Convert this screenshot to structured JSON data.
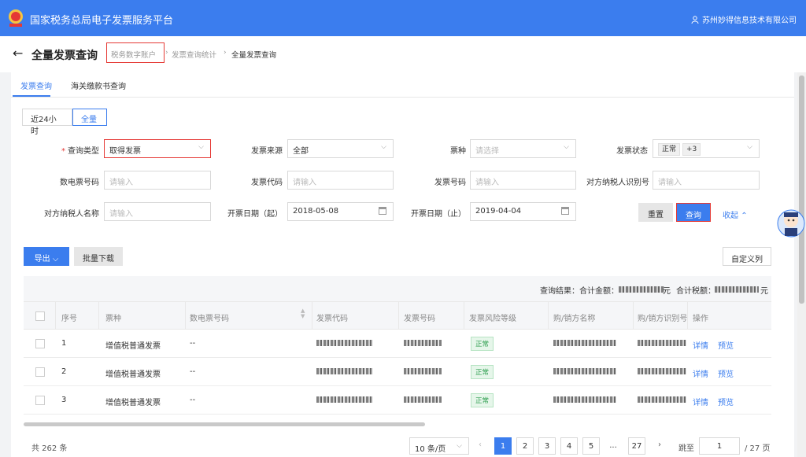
{
  "header": {
    "title": "国家税务总局电子发票服务平台",
    "user": "苏州妙得信息技术有限公司"
  },
  "breadcrumb": {
    "page_title": "全量发票查询",
    "items": [
      "税务数字账户",
      "发票查询统计",
      "全量发票查询"
    ]
  },
  "tabs": [
    "发票查询",
    "海关缴款书查询"
  ],
  "time_range": [
    "近24小时",
    "全量"
  ],
  "form": {
    "query_type_label": "查询类型",
    "query_type_value": "取得发票",
    "source_label": "发票来源",
    "source_value": "全部",
    "kind_label": "票种",
    "kind_placeholder": "请选择",
    "status_label": "发票状态",
    "status_tag": "正常",
    "status_more": "+3",
    "digital_no_label": "数电票号码",
    "digital_no_placeholder": "请输入",
    "code_label": "发票代码",
    "code_placeholder": "请输入",
    "number_label": "发票号码",
    "number_placeholder": "请输入",
    "taxid_label": "对方纳税人识别号",
    "taxid_placeholder": "请输入",
    "name_label": "对方纳税人名称",
    "name_placeholder": "请输入",
    "date_start_label": "开票日期（起）",
    "date_start": "2018-05-08",
    "date_end_label": "开票日期（止）",
    "date_end": "2019-04-04",
    "reset": "重置",
    "search": "查询",
    "collapse": "收起"
  },
  "toolbar": {
    "export": "导出",
    "batch_download": "批量下载",
    "custom_columns": "自定义列"
  },
  "summary": {
    "result_label": "查询结果：",
    "total_amount_label": "合计金额：",
    "total_amount_unit": "元",
    "total_tax_label": "合计税额：",
    "total_tax_unit": "元"
  },
  "table": {
    "headers": [
      "序号",
      "票种",
      "数电票号码",
      "发票代码",
      "发票号码",
      "发票风险等级",
      "购/销方名称",
      "购/销方识别号",
      "操作"
    ],
    "rows": [
      {
        "no": "1",
        "kind": "增值税普通发票",
        "digital_no": "--",
        "risk": "正常"
      },
      {
        "no": "2",
        "kind": "增值税普通发票",
        "digital_no": "--",
        "risk": "正常"
      },
      {
        "no": "3",
        "kind": "增值税普通发票",
        "digital_no": "--",
        "risk": "正常"
      }
    ],
    "actions": [
      "详情",
      "预览"
    ]
  },
  "pagination": {
    "total": "共 262 条",
    "page_size": "10 条/页",
    "pages": [
      "1",
      "2",
      "3",
      "4",
      "5",
      "...",
      "27"
    ],
    "jump_label": "跳至",
    "jump_value": "1",
    "page_total": "/ 27 页"
  },
  "colors": {
    "brand": "#3b7dee",
    "highlight": "#e53935",
    "ok": "#2e9e4f"
  }
}
